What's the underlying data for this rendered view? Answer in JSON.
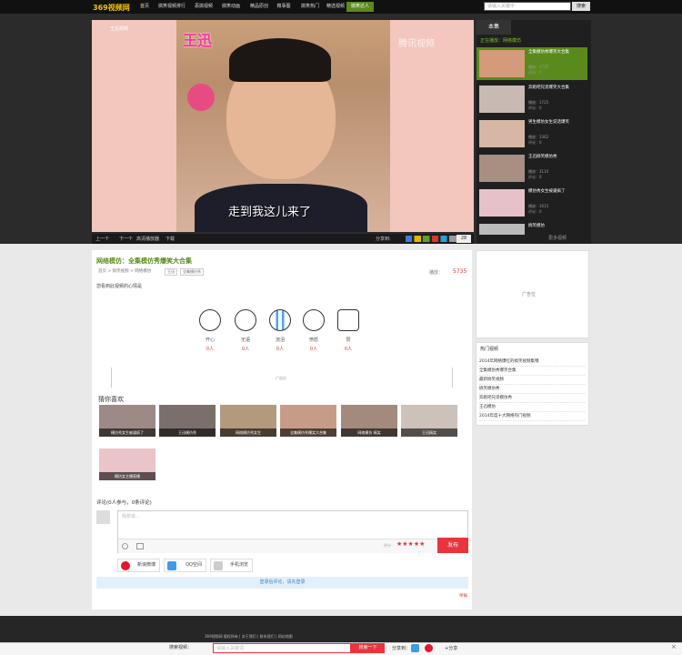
{
  "header": {
    "logo": "369视频网",
    "search_placeholder": "请输入关键字",
    "search_button": "搜索",
    "nav": [
      "首页",
      "搞笑视频排行",
      "恶搞视频",
      "搞笑动画",
      "精品原创",
      "糗事图",
      "搞笑热门",
      "精选视频",
      "搞笑达人"
    ],
    "active_nav_index": 8
  },
  "player": {
    "name_badge": "王迅",
    "caption": "走到我这儿来了",
    "watermark": "腾讯视频",
    "top_left_tag": "王迅视频",
    "controls": [
      "上一个",
      "下一个",
      "高清播放器",
      "下载"
    ],
    "controls_right": "分享到:"
  },
  "sidebar": {
    "tab": "本集",
    "now_playing": "正在播放：网络模仿",
    "items": [
      {
        "title": "全集模仿秀爆笑大合集",
        "meta1": "播放：5735",
        "meta2": "评论：0"
      },
      {
        "title": "奔跑吧兄弟爆笑大合集",
        "meta1": "播放：3725",
        "meta2": "评论：0"
      },
      {
        "title": "男生模仿女生说话爆笑",
        "meta1": "播放：3362",
        "meta2": "评论：0"
      },
      {
        "title": "王迅搞笑模仿秀",
        "meta1": "播放：3110",
        "meta2": "评论：0"
      },
      {
        "title": "模仿秀女生被逼疯了",
        "meta1": "播放：3015",
        "meta2": "评论：0"
      },
      {
        "title": "搞笑模仿",
        "meta1": "",
        "meta2": ""
      }
    ],
    "more": "更多视频"
  },
  "video": {
    "title": "网络模仿：全集模仿秀爆笑大合集",
    "breadcrumb": "首页 > 搞笑视频 > 网络模仿",
    "tags": [
      "王迅",
      "全集模仿秀"
    ],
    "play_label": "播放：",
    "play_count": "5735"
  },
  "mood": {
    "title": "您看到此视频的心情是",
    "items": [
      {
        "label": "开心",
        "count": "0人",
        "icon": "laugh-face"
      },
      {
        "label": "无语",
        "count": "0人",
        "icon": "speechless-face"
      },
      {
        "label": "流泪",
        "count": "0人",
        "icon": "crying-face"
      },
      {
        "label": "愤怒",
        "count": "0人",
        "icon": "angry-face"
      },
      {
        "label": "赞",
        "count": "0人",
        "icon": "thumbs-up"
      }
    ]
  },
  "ad_strip": "广告位",
  "guess": {
    "title": "猜你喜欢",
    "items": [
      "模仿秀女生被逼疯了",
      "王迅模仿秀",
      "网络模仿秀女生",
      "全集模仿秀爆笑大合集",
      "网络模仿 搞笑",
      "王迅搞笑",
      "模仿女主播直播"
    ]
  },
  "comments": {
    "head": "评论(0人参与，0条评论)",
    "placeholder": "我想说...",
    "stars_label": "评分",
    "stars": "★★★★★",
    "publish": "发布",
    "share": [
      "新浪微博",
      "QQ空间",
      "手机浏览"
    ],
    "login": "登录后评论，请先登录",
    "report": "举报"
  },
  "right_ad": "广告位",
  "hot": {
    "title": "热门视频",
    "items": [
      "2014年网络爆红的搞笑视频集锦",
      "全集模仿秀爆笑合集",
      "最新搞笑视频",
      "搞笑模仿秀",
      "奔跑吧兄弟模仿秀",
      "王迅模仿",
      "2014年度十大网络热门视频"
    ]
  },
  "footer": {
    "text": "369视频网 版权所有 | 关于我们 | 联系我们 | 网站地图",
    "bottom_label": "搜索视频：",
    "bottom_placeholder": "请输入关键词",
    "bottom_button": "搜索一下",
    "share_label": "分享到：",
    "share_text": "+分享",
    "close": "×"
  }
}
